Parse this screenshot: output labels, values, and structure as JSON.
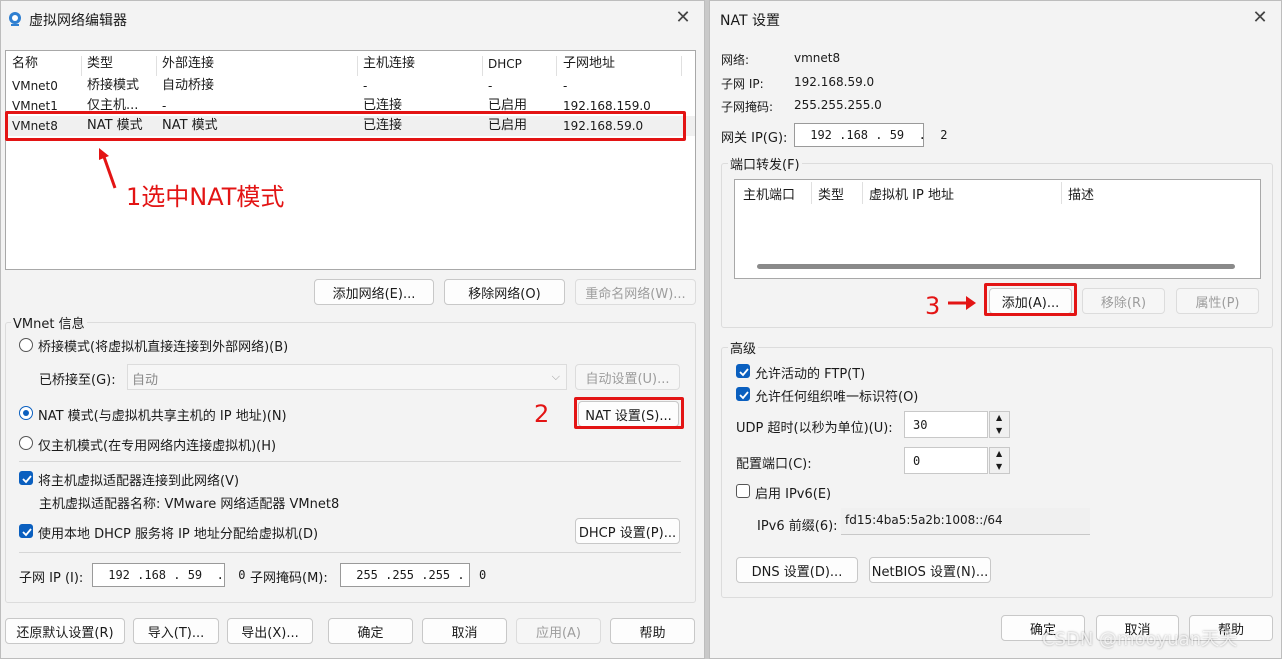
{
  "left": {
    "title": "虚拟网络编辑器",
    "columns": [
      "名称",
      "类型",
      "外部连接",
      "主机连接",
      "DHCP",
      "子网地址"
    ],
    "rows": [
      [
        "VMnet0",
        "桥接模式",
        "自动桥接",
        "-",
        "-",
        "-"
      ],
      [
        "VMnet1",
        "仅主机...",
        "-",
        "已连接",
        "已启用",
        "192.168.159.0"
      ],
      [
        "VMnet8",
        "NAT 模式",
        "NAT 模式",
        "已连接",
        "已启用",
        "192.168.59.0"
      ]
    ],
    "annotation1": "1选中NAT模式",
    "buttons": {
      "add": "添加网络(E)...",
      "remove": "移除网络(O)",
      "rename": "重命名网络(W)..."
    },
    "vmnet_info": "VMnet 信息",
    "bridge_radio": "桥接模式(将虚拟机直接连接到外部网络)(B)",
    "bridged_to_label": "已桥接至(G):",
    "bridged_to_value": "自动",
    "auto_settings": "自动设置(U)...",
    "nat_radio": "NAT 模式(与虚拟机共享主机的 IP 地址)(N)",
    "nat_settings": "NAT 设置(S)...",
    "annotation2": "2",
    "hostonly_radio": "仅主机模式(在专用网络内连接虚拟机)(H)",
    "connect_adapter": "将主机虚拟适配器连接到此网络(V)",
    "adapter_name": "主机虚拟适配器名称: VMware 网络适配器 VMnet8",
    "use_dhcp": "使用本地 DHCP 服务将 IP 地址分配给虚拟机(D)",
    "dhcp_settings": "DHCP 设置(P)...",
    "subnet_ip_label": "子网 IP (I):",
    "subnet_ip_value": " 192 .168 . 59  .  0",
    "subnet_mask_label": "子网掩码(M):",
    "subnet_mask_value": " 255 .255 .255 .  0",
    "restore": "还原默认设置(R)",
    "import": "导入(T)...",
    "export": "导出(X)...",
    "ok": "确定",
    "cancel": "取消",
    "apply": "应用(A)",
    "help": "帮助"
  },
  "right": {
    "title": "NAT 设置",
    "network_label": "网络:",
    "network_value": "vmnet8",
    "subnet_ip_label": "子网 IP:",
    "subnet_ip_value": "192.168.59.0",
    "subnet_mask_label": "子网掩码:",
    "subnet_mask_value": "255.255.255.0",
    "gateway_label": "网关 IP(G):",
    "gateway_value": " 192 .168 . 59  .  2",
    "port_forward": "端口转发(F)",
    "pf_columns": [
      "主机端口",
      "类型",
      "虚拟机 IP 地址",
      "描述"
    ],
    "add": "添加(A)...",
    "remove": "移除(R)",
    "properties": "属性(P)",
    "annotation3": "3",
    "advanced": "高级",
    "allow_ftp": "允许活动的 FTP(T)",
    "allow_oui": "允许任何组织唯一标识符(O)",
    "udp_label": "UDP 超时(以秒为单位)(U):",
    "udp_value": "30",
    "config_port_label": "配置端口(C):",
    "config_port_value": "0",
    "enable_ipv6": "启用 IPv6(E)",
    "ipv6_prefix_label": "IPv6 前缀(6):",
    "ipv6_prefix_value": "fd15:4ba5:5a2b:1008::/64",
    "dns": "DNS 设置(D)...",
    "netbios": "NetBIOS 设置(N)...",
    "ok": "确定",
    "cancel": "取消",
    "help": "帮助",
    "watermark": "CSDN @mooyuan天天"
  }
}
